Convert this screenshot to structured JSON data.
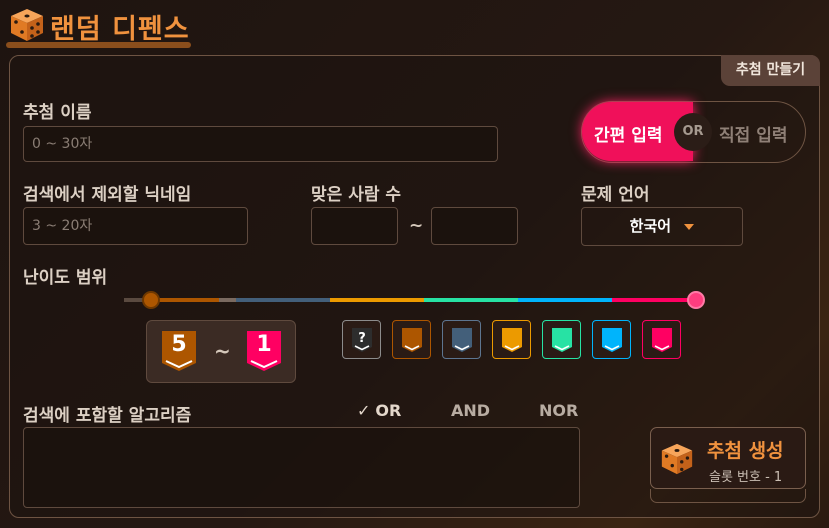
{
  "app": {
    "title": "랜덤 디펜스"
  },
  "panel": {
    "tab_label": "추첨 만들기"
  },
  "form": {
    "name_label": "추첨 이름",
    "name_placeholder": "0 ~ 30자",
    "exclude_label": "검색에서 제외할 닉네임",
    "exclude_placeholder": "3 ~ 20자",
    "solved_label": "맞은 사람 수",
    "solved_separator": "~",
    "lang_label": "문제 언어",
    "lang_value": "한국어",
    "difficulty_label": "난이도 범위",
    "difficulty_min": "5",
    "difficulty_separator": "~",
    "difficulty_max": "1",
    "algo_label": "검색에 포함할 알고리즘"
  },
  "toggle": {
    "left": "간편 입력",
    "or": "OR",
    "right": "직접 입력",
    "active": "left"
  },
  "algo_modes": {
    "or": "OR",
    "and": "AND",
    "nor": "NOR",
    "selected": "OR"
  },
  "tiers": [
    {
      "name": "unrated",
      "label": "?",
      "color": "#2d2d2d",
      "border": "#8c8c8c"
    },
    {
      "name": "bronze",
      "color": "#ad5600",
      "border": "#ad5600"
    },
    {
      "name": "silver",
      "color": "#435f7a",
      "border": "#5d7590"
    },
    {
      "name": "gold",
      "color": "#ec9a00",
      "border": "#ec9a00"
    },
    {
      "name": "platinum",
      "color": "#27e2a4",
      "border": "#27e2a4"
    },
    {
      "name": "diamond",
      "color": "#00b4fc",
      "border": "#00b4fc"
    },
    {
      "name": "ruby",
      "color": "#ff0062",
      "border": "#ff0062"
    }
  ],
  "generate": {
    "label": "추첨 생성",
    "slot": "슬롯 번호 - 1"
  },
  "colors": {
    "accent": "#f0923e",
    "toggle_active": "#f0105a"
  }
}
